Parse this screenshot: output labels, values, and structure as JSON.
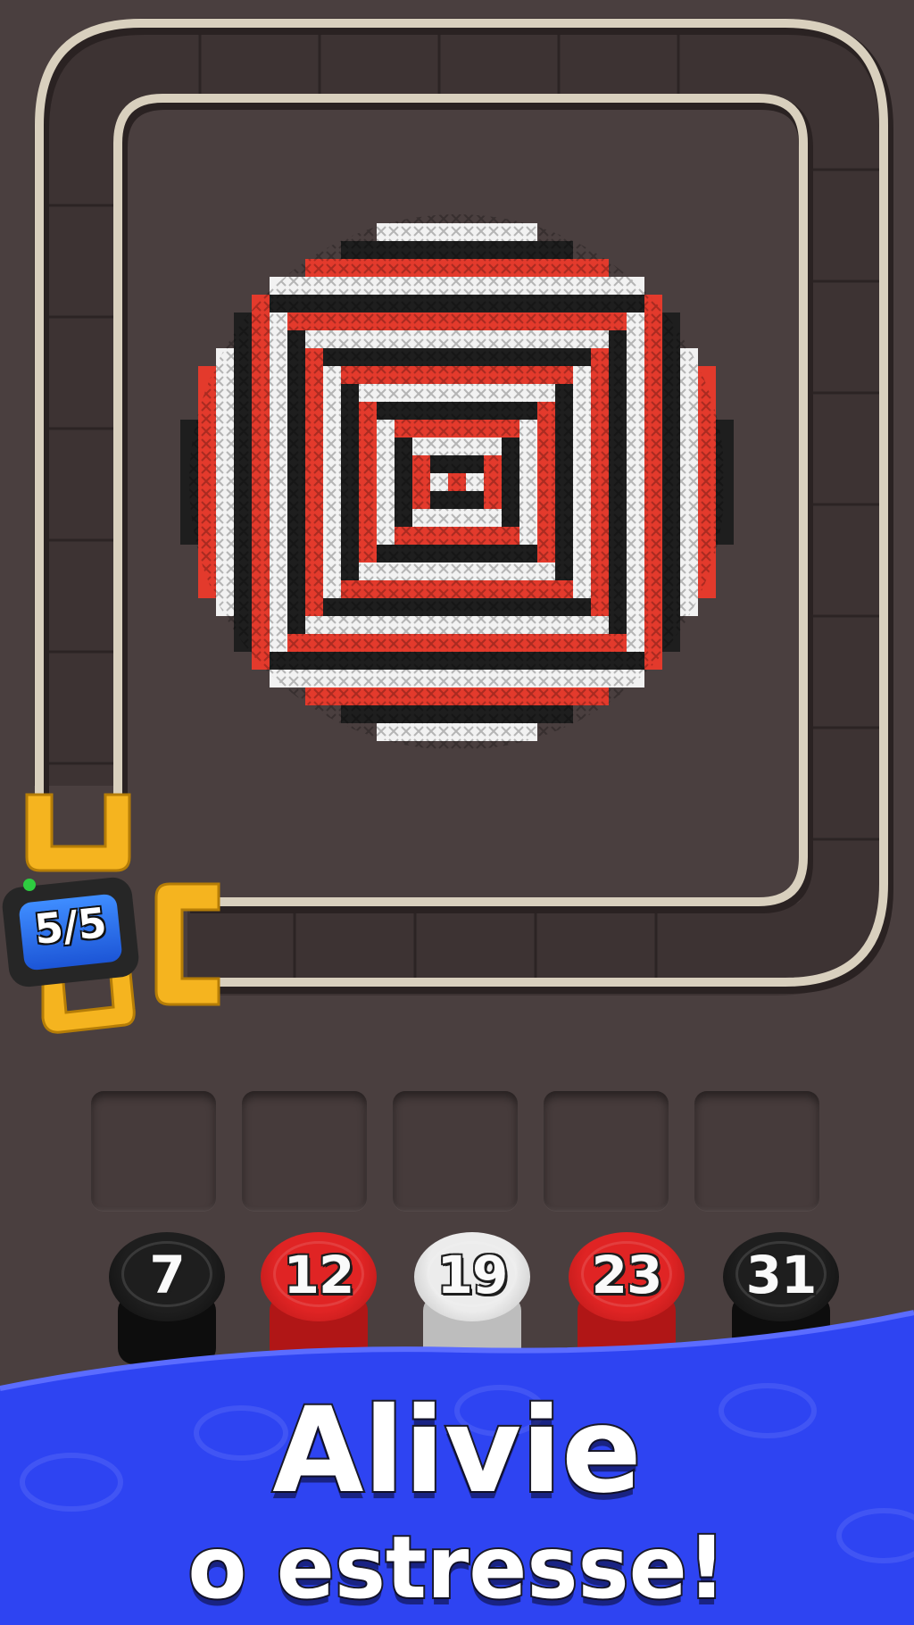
{
  "counter": {
    "text": "5/5"
  },
  "slots": [
    {},
    {},
    {},
    {},
    {}
  ],
  "spools": [
    {
      "number": "7",
      "color": "#1e1e1e",
      "shade": "#0d0d0d"
    },
    {
      "number": "12",
      "color": "#e02424",
      "shade": "#b01616"
    },
    {
      "number": "19",
      "color": "#ececec",
      "shade": "#bdbdbd"
    },
    {
      "number": "23",
      "color": "#e02424",
      "shade": "#b01616"
    },
    {
      "number": "31",
      "color": "#1e1e1e",
      "shade": "#0d0d0d"
    }
  ],
  "banner": {
    "line1": "Alivie",
    "line2": "o estresse!",
    "color": "#2e44f2"
  },
  "colors": {
    "background": "#4a3f3f",
    "rail": "#d9d0be",
    "clip": "#f5b41f",
    "stitch_red": "#e33a2c",
    "stitch_white": "#f2f2f2",
    "stitch_black": "#1e1e1e"
  }
}
